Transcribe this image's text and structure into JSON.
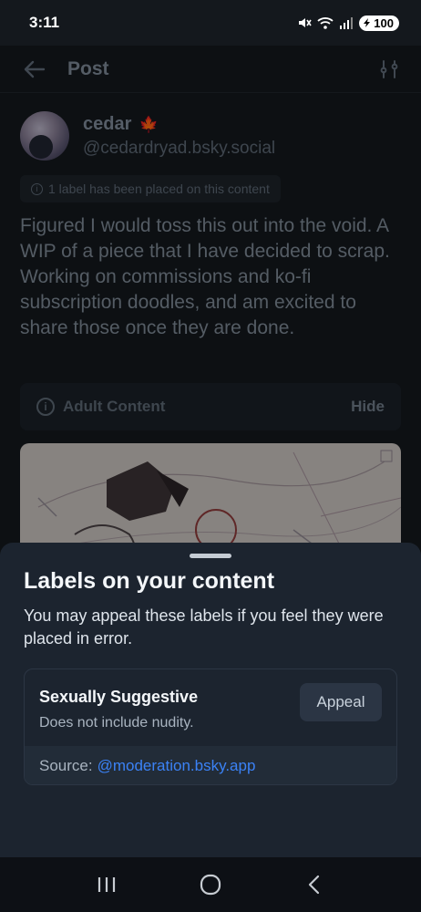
{
  "status_bar": {
    "time": "3:11",
    "battery": "100"
  },
  "header": {
    "title": "Post"
  },
  "post": {
    "author_name": "cedar",
    "author_handle": "@cedardryad.bsky.social",
    "label_notice": "1 label has been placed on this content",
    "text": "Figured I would toss this out into the void. A WIP of a piece that I have decided to scrap. Working on commissions and ko-fi subscription doodles, and am excited to share those once they are done.",
    "content_warning": {
      "label": "Adult Content",
      "action": "Hide"
    }
  },
  "sheet": {
    "title": "Labels on your content",
    "description": "You may appeal these labels if you feel they were placed in error.",
    "label": {
      "name": "Sexually Suggestive",
      "description": "Does not include nudity.",
      "appeal_button": "Appeal",
      "source_prefix": "Source:",
      "source_link": "@moderation.bsky.app"
    }
  },
  "colors": {
    "accent_link": "#3b82f6",
    "sheet_bg": "#1c242f",
    "page_bg": "#14181d"
  }
}
